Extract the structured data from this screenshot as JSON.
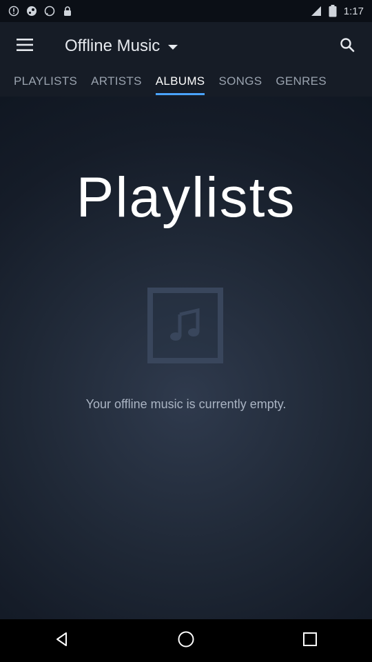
{
  "status_bar": {
    "time": "1:17",
    "icons": [
      "signal-icon",
      "steam-icon",
      "whatsapp-icon",
      "lock-icon",
      "signal-strength-icon",
      "battery-icon"
    ]
  },
  "app_bar": {
    "title": "Offline Music",
    "menu_icon": "menu-icon",
    "search_icon": "search-icon"
  },
  "tabs": [
    {
      "label": "PLAYLISTS",
      "active": false
    },
    {
      "label": "ARTISTS",
      "active": false
    },
    {
      "label": "ALBUMS",
      "active": true
    },
    {
      "label": "SONGS",
      "active": false
    },
    {
      "label": "GENRES",
      "active": false
    }
  ],
  "main": {
    "heading": "Playlists",
    "empty_message": "Your offline music is currently empty.",
    "empty_icon": "music-note-icon"
  },
  "nav_bar": {
    "back_icon": "back-icon",
    "home_icon": "home-icon",
    "recents_icon": "recents-icon"
  },
  "colors": {
    "accent": "#4aa3ff",
    "app_bar": "#161c26"
  }
}
